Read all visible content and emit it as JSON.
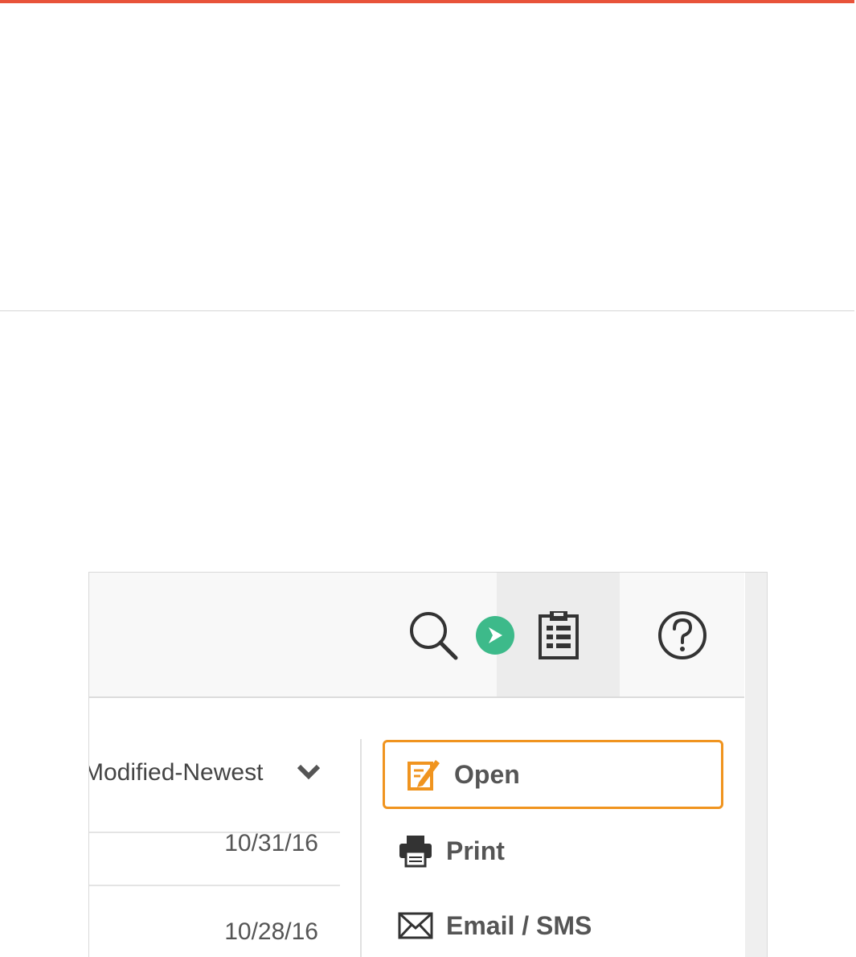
{
  "toolbar": {
    "search_icon": "search-icon",
    "clipboard_icon": "clipboard-icon",
    "help_icon": "help-icon",
    "marker_color": "#3dba8a"
  },
  "list": {
    "sort_label": "Modified-Newest",
    "rows": [
      {
        "date": "10/31/16"
      },
      {
        "date": "10/28/16"
      }
    ]
  },
  "menu": {
    "items": [
      {
        "label": "Open",
        "icon": "edit-icon",
        "highlighted": true
      },
      {
        "label": "Print",
        "icon": "printer-icon"
      },
      {
        "label": "Email / SMS",
        "icon": "envelope-icon"
      }
    ],
    "highlight_color": "#f0941f"
  },
  "colors": {
    "top_accent": "#e8533a",
    "open_icon": "#f0941f",
    "text": "#555555"
  }
}
